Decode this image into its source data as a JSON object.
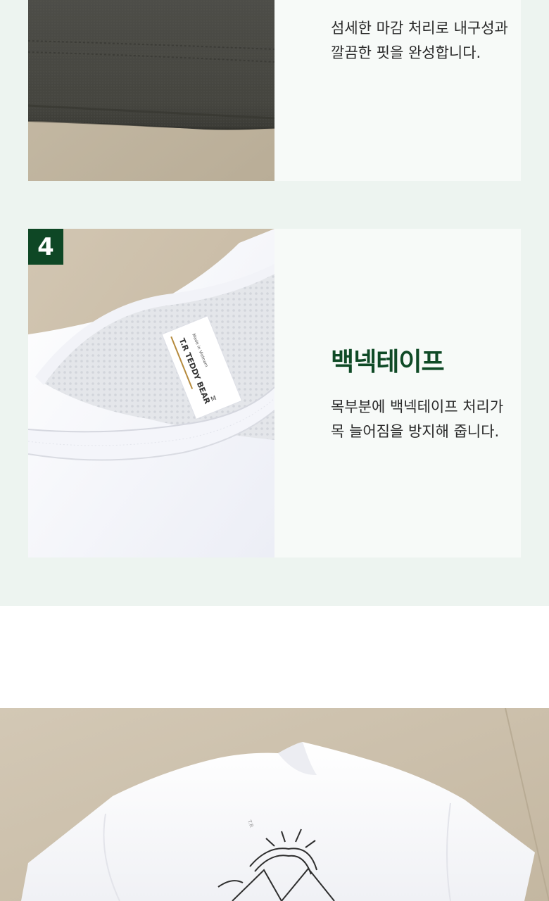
{
  "features": [
    {
      "id": 3,
      "description": "섬세한 마감 처리로 내구성과\n깔끔한 핏을 완성합니다.",
      "image_icon": "fabric-hem-photo"
    },
    {
      "id": 4,
      "badge": "4",
      "title": "백넥테이프",
      "description": "목부분에 백넥테이프 처리가\n목 늘어짐을 방지해 줍니다.",
      "image_icon": "neck-tape-photo",
      "label_text": {
        "brand": "T.R TEDDY BEAR",
        "origin": "Made in Vietnam",
        "size": "M"
      }
    }
  ],
  "colors": {
    "section_bg": "#edf4f0",
    "card_bg": "#f7faf8",
    "accent_green": "#0e4725",
    "body_text": "#2a2a2a"
  },
  "bottom": {
    "image_icon": "white-tshirt-photo",
    "label_text": "T.R"
  }
}
